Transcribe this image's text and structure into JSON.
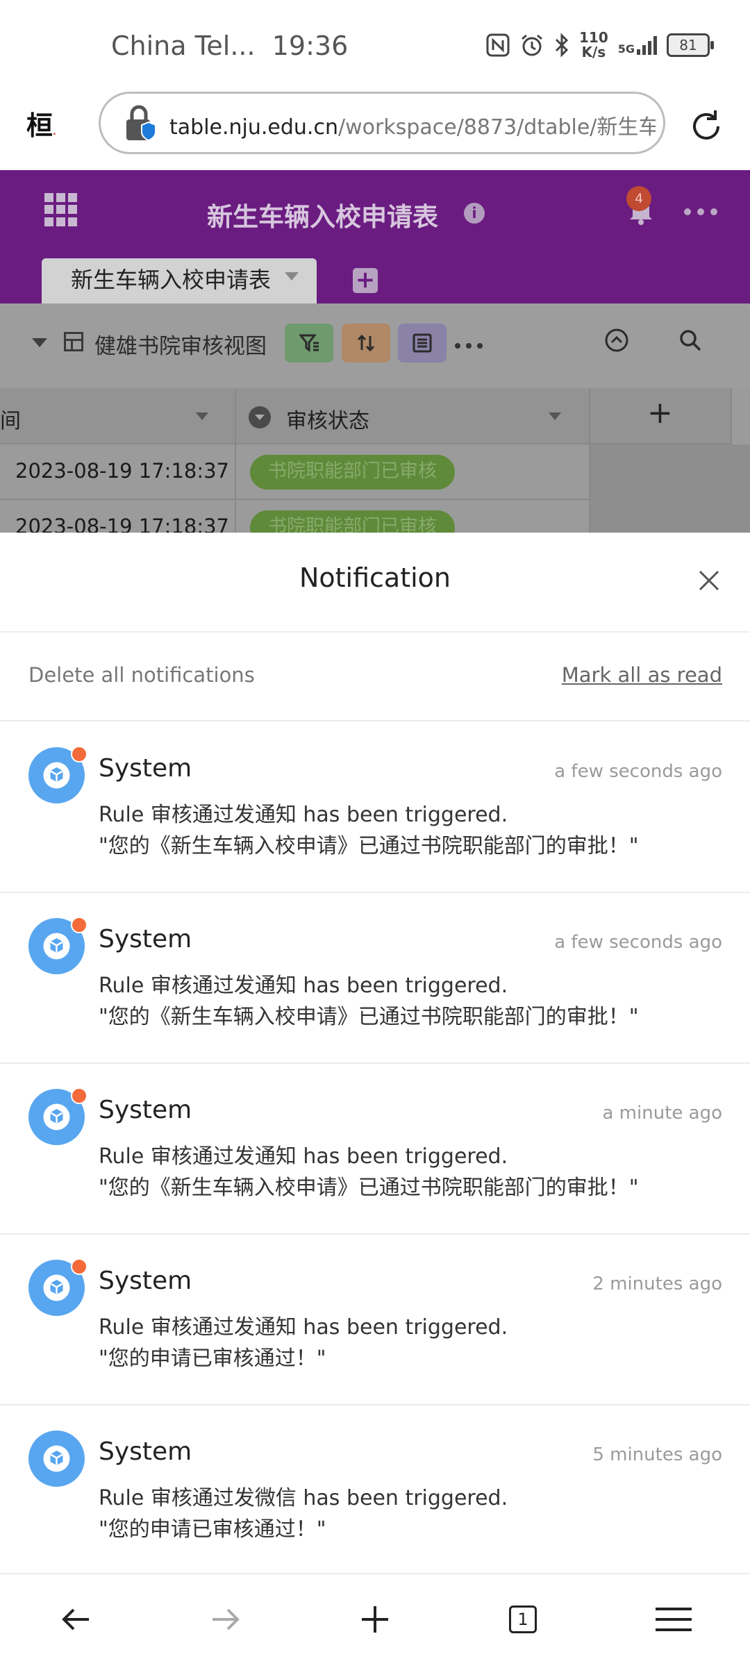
{
  "status_bar": {
    "carrier": "China Tel...",
    "time": "19:36",
    "net_speed_value": "110",
    "net_speed_unit": "K/s",
    "signal": "5G",
    "battery": "81"
  },
  "browser": {
    "url_host": "table.nju.edu.cn",
    "url_path": "/workspace/8873/dtable/新生车辆入"
  },
  "header": {
    "title": "新生车辆入校申请表",
    "notification_badge": "4"
  },
  "tabs": [
    {
      "label": "新生车辆入校申请表"
    }
  ],
  "toolbar": {
    "view_name": "健雄书院审核视图"
  },
  "grid": {
    "col1_header": "间",
    "col2_header": "审核状态",
    "rows": [
      {
        "time": "2023-08-19 17:18:37",
        "status": "书院职能部门已审核"
      },
      {
        "time": "2023-08-19 17:18:37",
        "status": "书院职能部门已审核"
      }
    ]
  },
  "notifications_panel": {
    "title": "Notification",
    "delete_all": "Delete all notifications",
    "mark_all": "Mark all as read",
    "items": [
      {
        "sender": "System",
        "time": "a few seconds ago",
        "line1": "Rule 审核通过发通知 has been triggered.",
        "line2": "\"您的《新生车辆入校申请》已通过书院职能部门的审批！\"",
        "unread": true
      },
      {
        "sender": "System",
        "time": "a few seconds ago",
        "line1": "Rule 审核通过发通知 has been triggered.",
        "line2": "\"您的《新生车辆入校申请》已通过书院职能部门的审批！\"",
        "unread": true
      },
      {
        "sender": "System",
        "time": "a minute ago",
        "line1": "Rule 审核通过发通知 has been triggered.",
        "line2": "\"您的《新生车辆入校申请》已通过书院职能部门的审批！\"",
        "unread": true
      },
      {
        "sender": "System",
        "time": "2 minutes ago",
        "line1": "Rule 审核通过发通知 has been triggered.",
        "line2": "\"您的申请已审核通过！\"",
        "unread": true
      },
      {
        "sender": "System",
        "time": "5 minutes ago",
        "line1": "Rule 审核通过发微信 has been triggered.",
        "line2": "\"您的申请已审核通过！\"",
        "unread": false
      }
    ]
  },
  "bottom_nav": {
    "tab_count": "1"
  },
  "colors": {
    "header_purple": "#6a1c80",
    "avatar_blue": "#58a6f0",
    "unread_dot": "#f36b3a",
    "status_pill_green": "#5f8a3a"
  }
}
